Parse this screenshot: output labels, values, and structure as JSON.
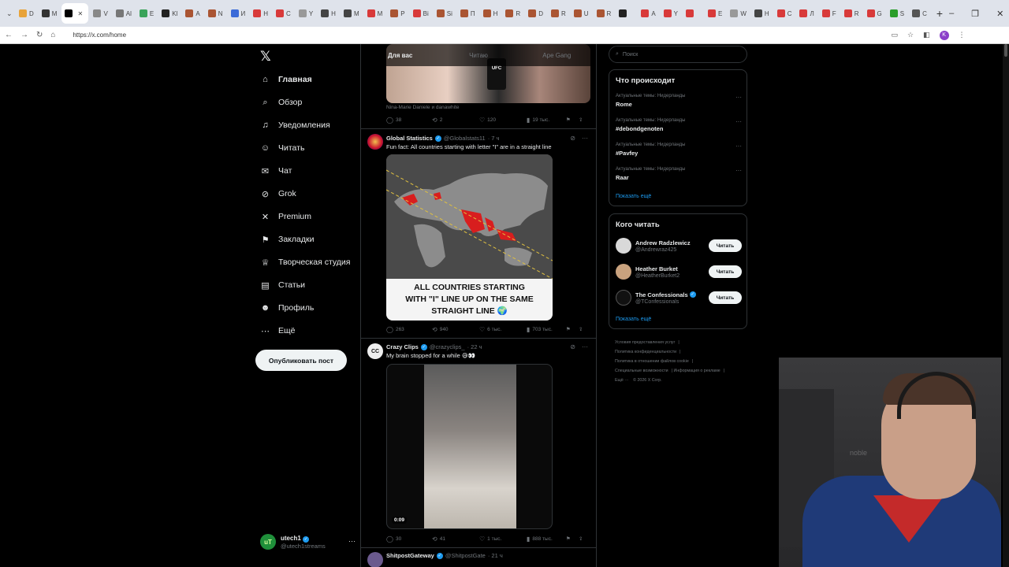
{
  "browser": {
    "tabs": [
      {
        "label": "D",
        "color": "#e8a33a"
      },
      {
        "label": "M",
        "color": "#333333"
      },
      {
        "label": "",
        "color": "#000000",
        "active": true
      },
      {
        "label": "V",
        "color": "#888888"
      },
      {
        "label": "Al",
        "color": "#777777"
      },
      {
        "label": "E",
        "color": "#3aa35a"
      },
      {
        "label": "Kl",
        "color": "#222222"
      },
      {
        "label": "A",
        "color": "#aa5533"
      },
      {
        "label": "N",
        "color": "#aa5533"
      },
      {
        "label": "И",
        "color": "#3a6ad8"
      },
      {
        "label": "H",
        "color": "#d83a3a"
      },
      {
        "label": "C",
        "color": "#d83a3a"
      },
      {
        "label": "Y",
        "color": "#999999"
      },
      {
        "label": "H",
        "color": "#444444"
      },
      {
        "label": "M",
        "color": "#444444"
      },
      {
        "label": "M",
        "color": "#d83a3a"
      },
      {
        "label": "P",
        "color": "#aa5533"
      },
      {
        "label": "Bi",
        "color": "#d83a3a"
      },
      {
        "label": "Si",
        "color": "#aa5533"
      },
      {
        "label": "П",
        "color": "#aa5533"
      },
      {
        "label": "H",
        "color": "#aa5533"
      },
      {
        "label": "R",
        "color": "#aa5533"
      },
      {
        "label": "D",
        "color": "#aa5533"
      },
      {
        "label": "R",
        "color": "#aa5533"
      },
      {
        "label": "U",
        "color": "#aa5533"
      },
      {
        "label": "R",
        "color": "#aa5533"
      },
      {
        "label": "",
        "color": "#222222"
      },
      {
        "label": "A",
        "color": "#d83a3a"
      },
      {
        "label": "Y",
        "color": "#d83a3a"
      },
      {
        "label": "",
        "color": "#d83a3a"
      },
      {
        "label": "E",
        "color": "#d83a3a"
      },
      {
        "label": "W",
        "color": "#999999"
      },
      {
        "label": "H",
        "color": "#444444"
      },
      {
        "label": "C",
        "color": "#d83a3a"
      },
      {
        "label": "Л",
        "color": "#d83a3a"
      },
      {
        "label": "F",
        "color": "#d83a3a"
      },
      {
        "label": "R",
        "color": "#d83a3a"
      },
      {
        "label": "G",
        "color": "#d83a3a"
      },
      {
        "label": "S",
        "color": "#2a9d2a"
      },
      {
        "label": "C",
        "color": "#555555"
      }
    ],
    "url": "https://x.com/home"
  },
  "nav": {
    "items": [
      {
        "label": "Главная",
        "icon": "home-icon",
        "glyph": "⌂",
        "bold": true
      },
      {
        "label": "Обзор",
        "icon": "search-icon",
        "glyph": "⌕"
      },
      {
        "label": "Уведомления",
        "icon": "bell-icon",
        "glyph": "♫"
      },
      {
        "label": "Читать",
        "icon": "people-icon",
        "glyph": "☺"
      },
      {
        "label": "Чат",
        "icon": "mail-icon",
        "glyph": "✉"
      },
      {
        "label": "Grok",
        "icon": "grok-icon",
        "glyph": "⊘"
      },
      {
        "label": "Premium",
        "icon": "x-premium-icon",
        "glyph": "✕"
      },
      {
        "label": "Закладки",
        "icon": "bookmark-icon",
        "glyph": "⚑"
      },
      {
        "label": "Творческая студия",
        "icon": "studio-icon",
        "glyph": "♕"
      },
      {
        "label": "Статьи",
        "icon": "articles-icon",
        "glyph": "▤"
      },
      {
        "label": "Профиль",
        "icon": "profile-icon",
        "glyph": "☻"
      },
      {
        "label": "Ещё",
        "icon": "more-icon",
        "glyph": "⋯"
      }
    ],
    "post_label": "Опубликовать пост",
    "account": {
      "name": "utech1",
      "handle": "@utech1streams",
      "avatar_text": "uT"
    }
  },
  "feed": {
    "tabs": [
      "Для вас",
      "Читаю",
      "Ape Gang"
    ],
    "first_post": {
      "caption": "Nina-Marie Daniele и danawhite",
      "mic_label": "UFC",
      "replies": "38",
      "reposts": "2",
      "likes": "120",
      "views": "19 тыс."
    },
    "tweets": [
      {
        "name": "Global Statistics",
        "handle": "@Globalstats11",
        "time": "· 7 ч",
        "text": "Fun fact: All countries starting with letter \"I\" are in a straight line",
        "media_lines": [
          "ALL COUNTRIES STARTING",
          "WITH \"I\" LINE UP ON THE SAME",
          "STRAIGHT LINE 🌍"
        ],
        "replies": "263",
        "reposts": "940",
        "likes": "6 тыс.",
        "views": "703 тыс."
      },
      {
        "name": "Crazy Clips",
        "handle": "@crazyclips_",
        "time": "· 22 ч",
        "text": "My brain stopped for a while 😅👀",
        "video_time": "0:09",
        "replies": "30",
        "reposts": "41",
        "likes": "1 тыс.",
        "views": "888 тыс."
      },
      {
        "name": "ShitpostGateway",
        "handle": "@ShitpostGate",
        "time": "· 21 ч"
      }
    ]
  },
  "sidebar": {
    "search_placeholder": "Поиск",
    "trends_title": "Что происходит",
    "trends": [
      {
        "meta": "Актуальные темы: Нидерланды",
        "name": "Rome"
      },
      {
        "meta": "Актуальные темы: Нидерланды",
        "name": "#debondgenoten"
      },
      {
        "meta": "Актуальные темы: Нидерланды",
        "name": "#Pavfey"
      },
      {
        "meta": "Актуальные темы: Нидерланды",
        "name": "Raar"
      }
    ],
    "trends_more": "Показать ещё",
    "who_title": "Кого читать",
    "who": [
      {
        "name": "Andrew Radzlewicz",
        "handle": "@Andrewraz425",
        "button": "Читать",
        "verified": false
      },
      {
        "name": "Heather Burket",
        "handle": "@HeatherBurket2",
        "button": "Читать",
        "verified": false
      },
      {
        "name": "The Confessionals",
        "handle": "@TConfessionals",
        "button": "Читать",
        "verified": true
      }
    ],
    "who_more": "Показать ещё",
    "footer": [
      "Условия предоставления услуг",
      "Политика конфиденциальности",
      "Политика в отношении файлов cookie",
      "Специальные возможности",
      "Информация о рекламе",
      "Ещё ···",
      "© 2026 X Corp."
    ]
  },
  "webcam": {
    "watermark": "noble"
  }
}
